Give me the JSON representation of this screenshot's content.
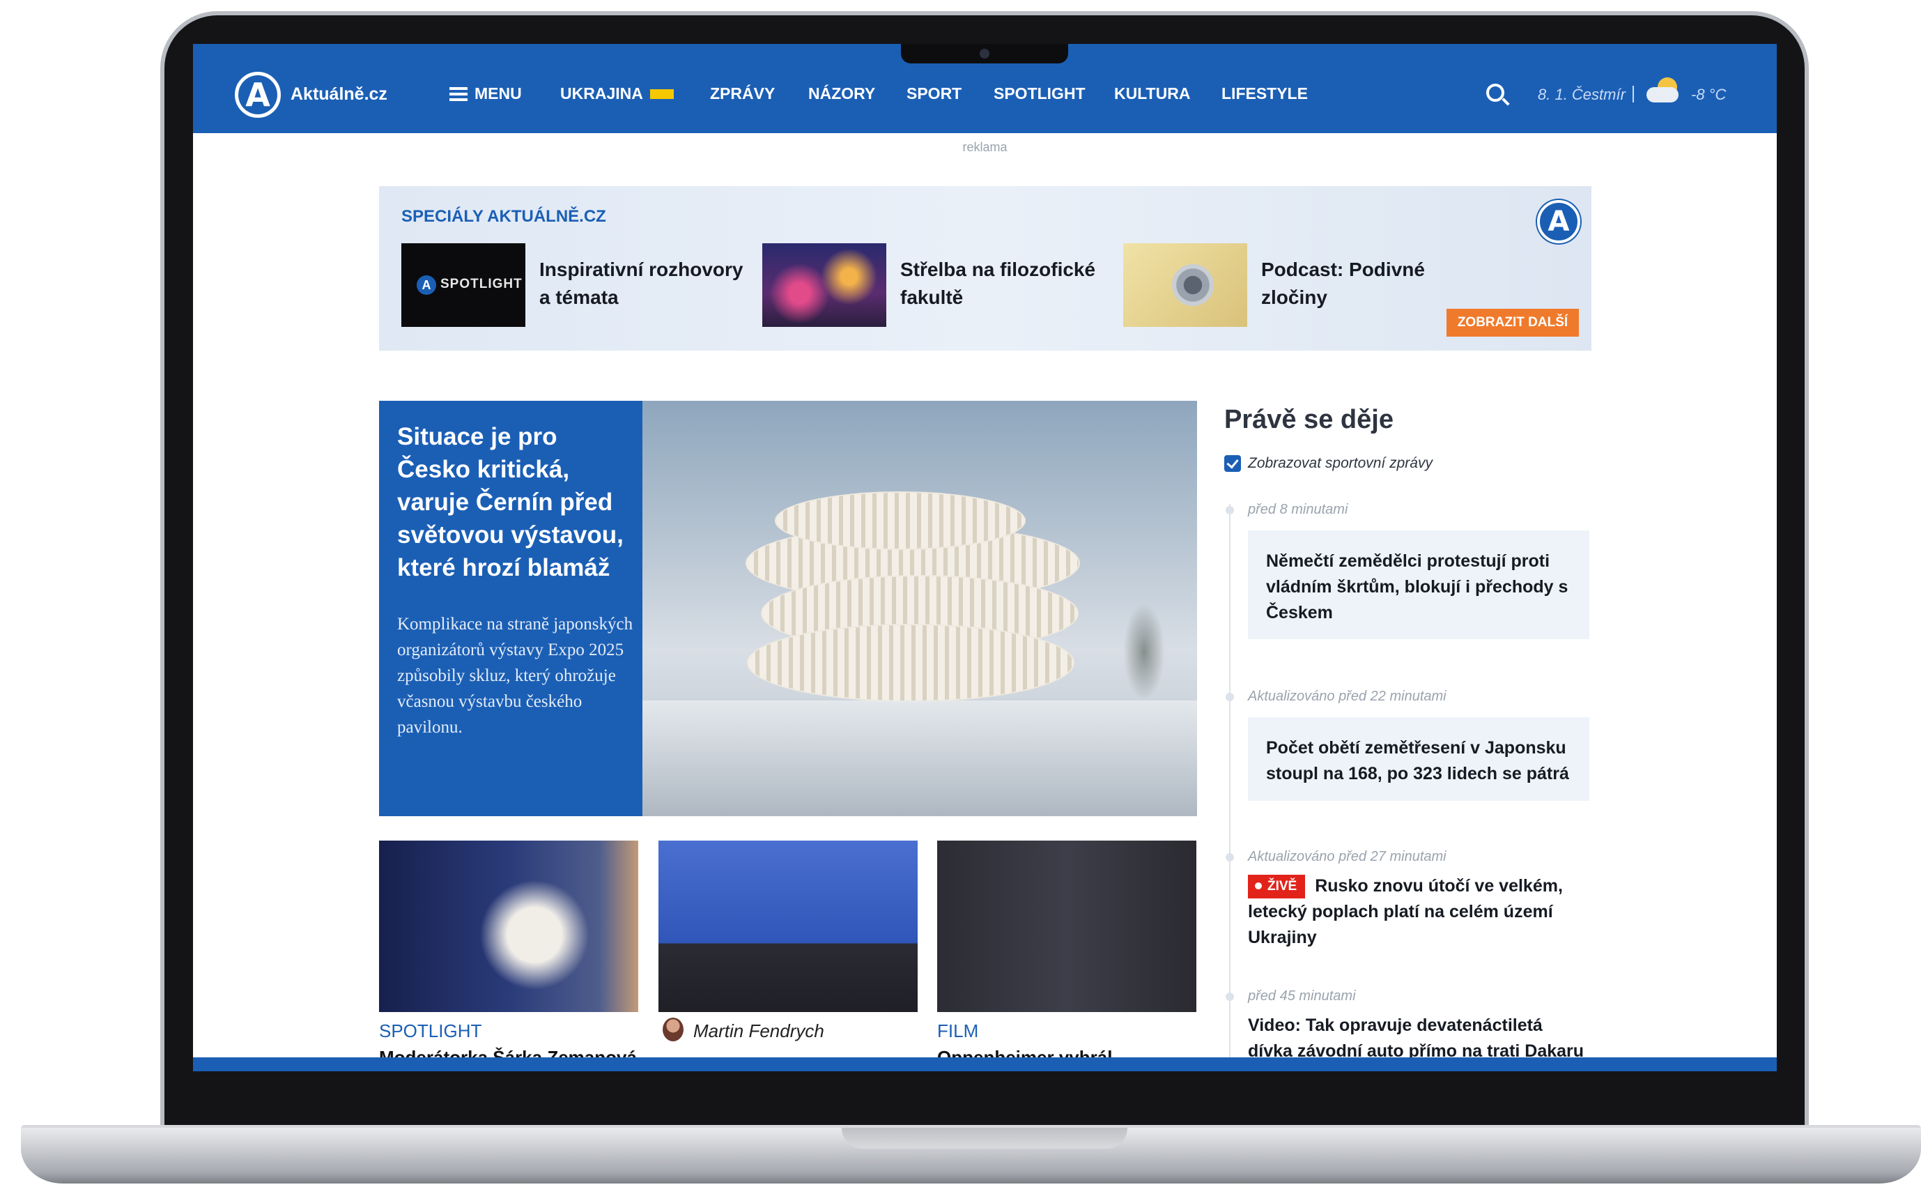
{
  "nav": {
    "logo_letter": "A",
    "logo_text": "Aktuálně.cz",
    "menu_label": "MENU",
    "items": [
      "UKRAJINA",
      "ZPRÁVY",
      "NÁZORY",
      "SPORT",
      "SPOTLIGHT",
      "KULTURA",
      "LIFESTYLE"
    ],
    "date_name": "8. 1. Čestmír",
    "separator": "|",
    "temperature": "-8 °C"
  },
  "ad_label": "reklama",
  "specials": {
    "title": "SPECIÁLY AKTUÁLNĚ.CZ",
    "logo_letter": "A",
    "items": [
      {
        "title": "Inspirativní rozhovory a témata",
        "thumb_text": "SPOTLIGHT"
      },
      {
        "title": "Střelba na filozofické fakultě"
      },
      {
        "title": "Podcast: Podivné zločiny"
      }
    ],
    "show_more": "ZOBRAZIT DALŠÍ"
  },
  "hero": {
    "title": "Situace je pro Česko kritická, varuje Černín před světovou výstavou, které hrozí blamáž",
    "perex": "Komplikace na straně japonských organizátorů výstavy Expo 2025 způsobily skluz, který ohrožuje včasnou výstavbu českého pavilonu."
  },
  "cards": [
    {
      "label": "SPOTLIGHT",
      "title_peek": "Moderátorka Šárka Zemanová"
    },
    {
      "author": "Martin Fendrych",
      "title_peek": ""
    },
    {
      "label": "FILM",
      "title_peek": "Oppenheimer vyhrál..."
    }
  ],
  "feed": {
    "title": "Právě se děje",
    "checkbox_label": "Zobrazovat sportovní zprávy",
    "live_label": "ŽIVĚ",
    "items": [
      {
        "time": "před 8 minutami",
        "text": "Němečtí zemědělci protestují proti vládním škrtům, blokují i přechody s Českem"
      },
      {
        "time": "Aktualizováno před 22 minutami",
        "text": "Počet obětí zemětřesení v Japonsku stoupl na 168, po 323 lidech se pátrá"
      },
      {
        "time": "Aktualizováno před 27 minutami",
        "text": "Rusko znovu útočí ve velkém, letecký poplach platí na celém území Ukrajiny"
      },
      {
        "time": "před 45 minutami",
        "text": "Video: Tak opravuje devatenáctiletá dívka závodní auto přímo na trati Dakaru"
      }
    ]
  },
  "colors": {
    "brand": "#1b5fb5",
    "accent": "#f07a2b",
    "live": "#e2231a"
  }
}
